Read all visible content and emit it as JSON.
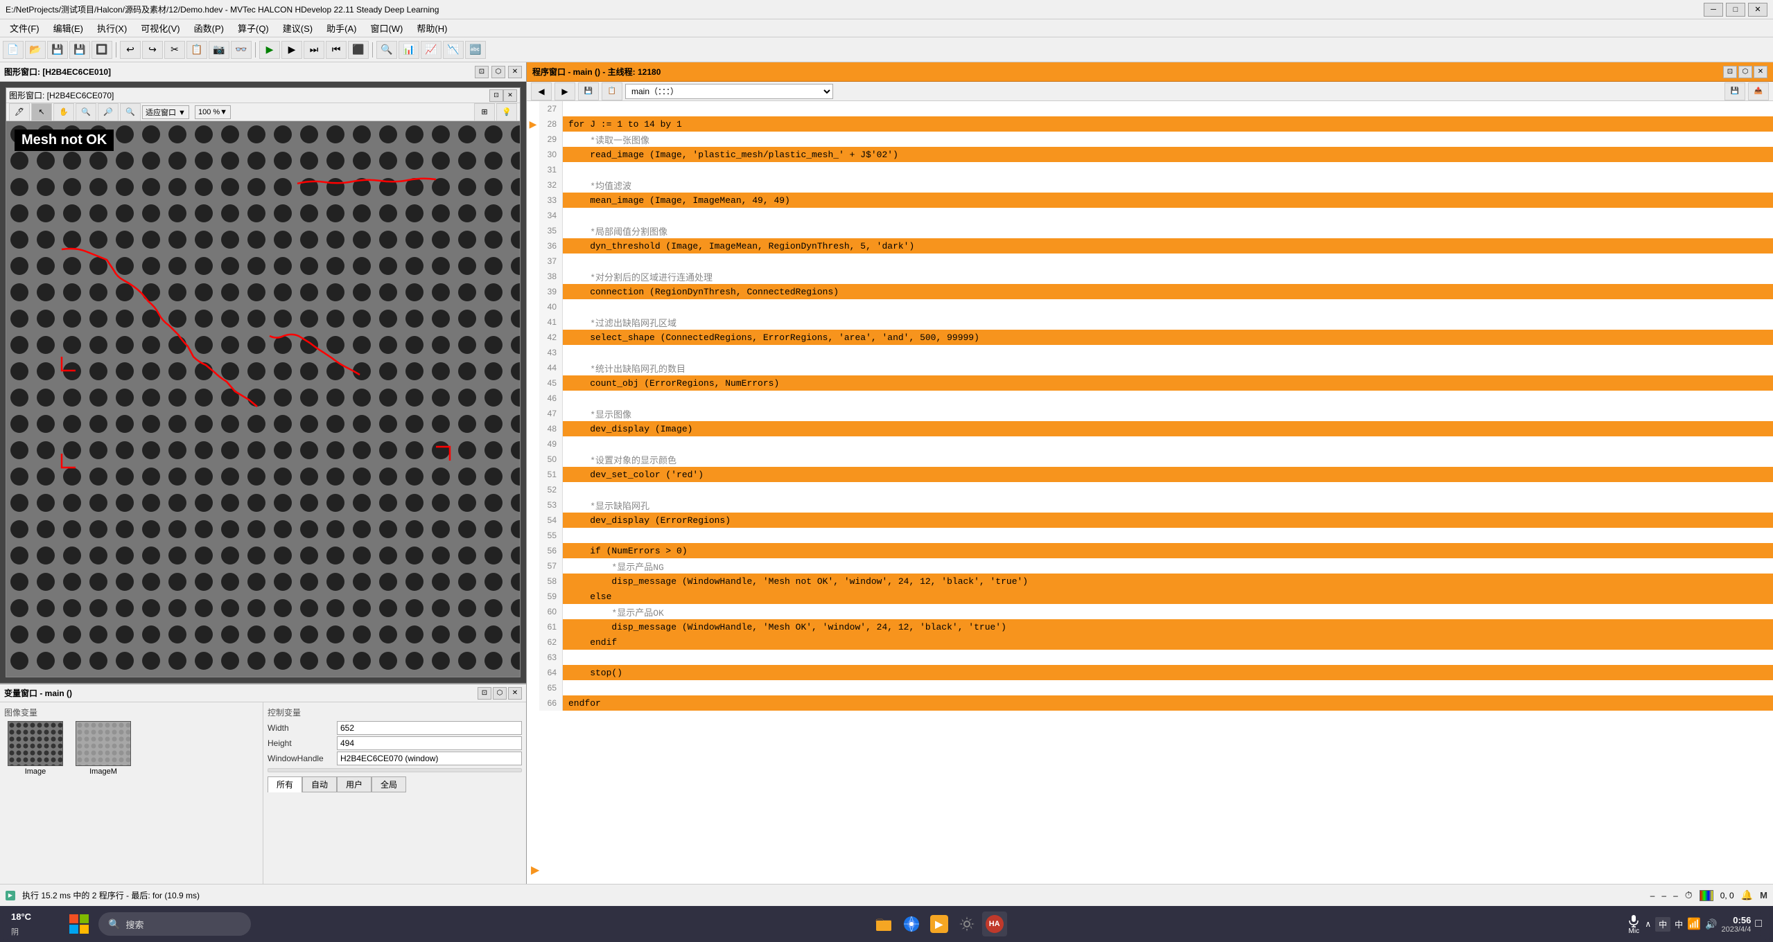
{
  "title": "E:/NetProjects/测试项目/Halcon/源码及素材/12/Demo.hdev - MVTec HALCON HDevelop 22.11 Steady Deep Learning",
  "menu": {
    "items": [
      "文件(F)",
      "编辑(E)",
      "执行(X)",
      "可视化(V)",
      "函数(P)",
      "算子(Q)",
      "建议(S)",
      "助手(A)",
      "窗口(W)",
      "帮助(H)"
    ]
  },
  "graphics_window": {
    "title": "图形窗口: [H2B4EC6CE010]",
    "inner_title": "图形窗口: [H2B4EC6CE070]",
    "zoom": "100 %"
  },
  "variables_window": {
    "title": "变量窗口 - main ()",
    "section_images": "图像变量",
    "section_control": "控制变量",
    "images": [
      {
        "name": "Image",
        "type": "mesh"
      },
      {
        "name": "ImageM",
        "type": "gray"
      }
    ],
    "controls": [
      {
        "label": "Width",
        "value": "652"
      },
      {
        "label": "Height",
        "value": "494"
      },
      {
        "label": "WindowHandle",
        "value": "H2B4EC6CE070 (window)"
      }
    ],
    "tabs": [
      "所有",
      "自动",
      "用户",
      "全局"
    ]
  },
  "code_window": {
    "title": "程序窗口 - main () - 主线程: 12180",
    "dropdown": "main（：：：）",
    "lines": [
      {
        "num": 27,
        "content": "",
        "highlighted": false,
        "comment": false
      },
      {
        "num": 28,
        "content": "for J := 1 to 14 by 1",
        "highlighted": true,
        "comment": false
      },
      {
        "num": 29,
        "content": "    *读取一张图像",
        "highlighted": false,
        "comment": true
      },
      {
        "num": 30,
        "content": "    read_image (Image, 'plastic_mesh/plastic_mesh_' + J$'02')",
        "highlighted": true,
        "comment": false
      },
      {
        "num": 31,
        "content": "",
        "highlighted": false,
        "comment": false
      },
      {
        "num": 32,
        "content": "    *均值滤波",
        "highlighted": false,
        "comment": true
      },
      {
        "num": 33,
        "content": "    mean_image (Image, ImageMean, 49, 49)",
        "highlighted": true,
        "comment": false
      },
      {
        "num": 34,
        "content": "",
        "highlighted": false,
        "comment": false
      },
      {
        "num": 35,
        "content": "    *局部阈值分割图像",
        "highlighted": false,
        "comment": true
      },
      {
        "num": 36,
        "content": "    dyn_threshold (Image, ImageMean, RegionDynThresh, 5, 'dark')",
        "highlighted": true,
        "comment": false
      },
      {
        "num": 37,
        "content": "",
        "highlighted": false,
        "comment": false
      },
      {
        "num": 38,
        "content": "    *对分割后的区域进行连通处理",
        "highlighted": false,
        "comment": true
      },
      {
        "num": 39,
        "content": "    connection (RegionDynThresh, ConnectedRegions)",
        "highlighted": true,
        "comment": false
      },
      {
        "num": 40,
        "content": "",
        "highlighted": false,
        "comment": false
      },
      {
        "num": 41,
        "content": "    *过滤出缺陷网孔区域",
        "highlighted": false,
        "comment": true
      },
      {
        "num": 42,
        "content": "    select_shape (ConnectedRegions, ErrorRegions, 'area', 'and', 500, 99999)",
        "highlighted": true,
        "comment": false
      },
      {
        "num": 43,
        "content": "",
        "highlighted": false,
        "comment": false
      },
      {
        "num": 44,
        "content": "    *统计出缺陷网孔的数目",
        "highlighted": false,
        "comment": true
      },
      {
        "num": 45,
        "content": "    count_obj (ErrorRegions, NumErrors)",
        "highlighted": true,
        "comment": false
      },
      {
        "num": 46,
        "content": "",
        "highlighted": false,
        "comment": false
      },
      {
        "num": 47,
        "content": "    *显示图像",
        "highlighted": false,
        "comment": true
      },
      {
        "num": 48,
        "content": "    dev_display (Image)",
        "highlighted": true,
        "comment": false
      },
      {
        "num": 49,
        "content": "",
        "highlighted": false,
        "comment": false
      },
      {
        "num": 50,
        "content": "    *设置对象的显示颜色",
        "highlighted": false,
        "comment": true
      },
      {
        "num": 51,
        "content": "    dev_set_color ('red')",
        "highlighted": true,
        "comment": false
      },
      {
        "num": 52,
        "content": "",
        "highlighted": false,
        "comment": false
      },
      {
        "num": 53,
        "content": "    *显示缺陷网孔",
        "highlighted": false,
        "comment": true
      },
      {
        "num": 54,
        "content": "    dev_display (ErrorRegions)",
        "highlighted": true,
        "comment": false
      },
      {
        "num": 55,
        "content": "",
        "highlighted": false,
        "comment": false
      },
      {
        "num": 56,
        "content": "    if (NumErrors > 0)",
        "highlighted": true,
        "comment": false
      },
      {
        "num": 57,
        "content": "        *显示产品NG",
        "highlighted": false,
        "comment": true
      },
      {
        "num": 58,
        "content": "        disp_message (WindowHandle, 'Mesh not OK', 'window', 24, 12, 'black', 'true')",
        "highlighted": true,
        "comment": false
      },
      {
        "num": 59,
        "content": "    else",
        "highlighted": true,
        "comment": false
      },
      {
        "num": 60,
        "content": "        *显示产品OK",
        "highlighted": false,
        "comment": true
      },
      {
        "num": 61,
        "content": "        disp_message (WindowHandle, 'Mesh OK', 'window', 24, 12, 'black', 'true')",
        "highlighted": true,
        "comment": false
      },
      {
        "num": 62,
        "content": "    endif",
        "highlighted": true,
        "comment": false
      },
      {
        "num": 63,
        "content": "",
        "highlighted": false,
        "comment": false
      },
      {
        "num": 64,
        "content": "    stop()",
        "highlighted": true,
        "comment": false
      },
      {
        "num": 65,
        "content": "",
        "highlighted": false,
        "comment": false
      },
      {
        "num": 66,
        "content": "endfor",
        "highlighted": true,
        "comment": false
      }
    ],
    "current_arrow_line": 28
  },
  "status_bar": {
    "text": "执行 15.2 ms 中的 2 程序行 - 最后: for (10.9 ms)"
  },
  "taskbar": {
    "weather": "18°C",
    "weather_desc": "阴",
    "search_placeholder": "搜索",
    "time": "0:56",
    "date": "2023/4/4",
    "mic_label": "Mic",
    "tray_items": [
      "中",
      "中",
      "0, 0"
    ]
  },
  "mesh_label": "Mesh not OK"
}
